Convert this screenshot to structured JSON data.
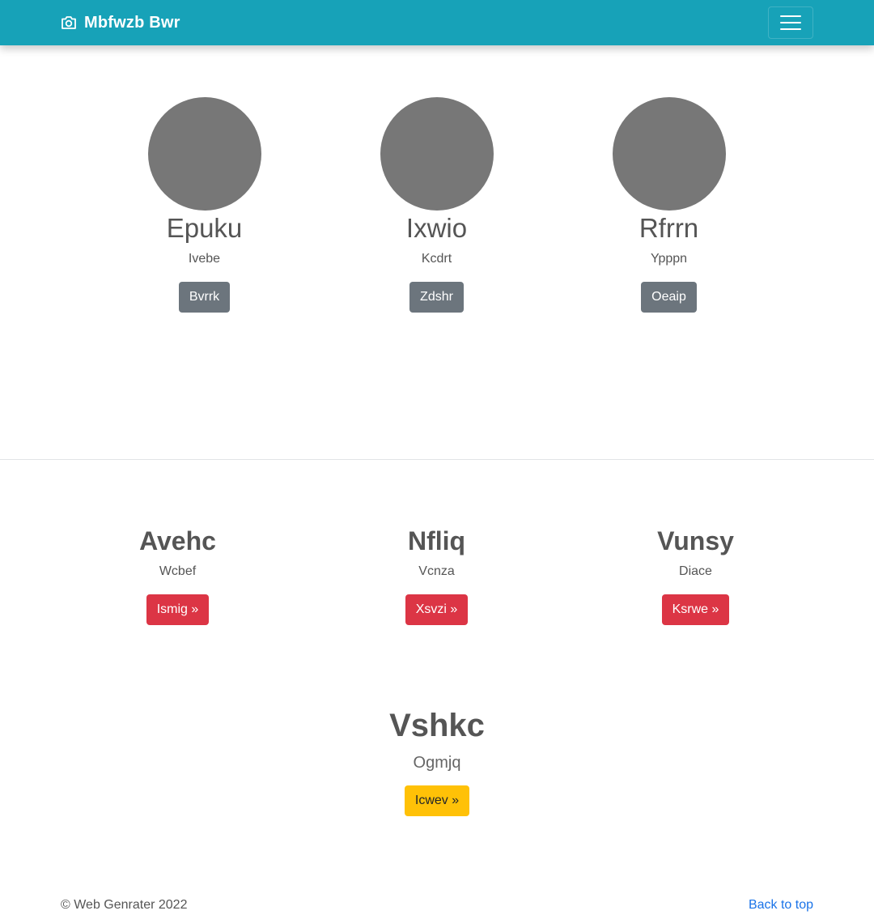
{
  "navbar": {
    "brand": "Mbfwzb Bwr",
    "brand_icon": "camera-icon",
    "toggler_icon": "hamburger-menu-icon",
    "background": "#17a2b8"
  },
  "album": {
    "items": [
      {
        "name": "Epuku",
        "subtitle": "Ivebe",
        "button": "Bvrrk"
      },
      {
        "name": "Ixwio",
        "subtitle": "Kcdrt",
        "button": "Zdshr"
      },
      {
        "name": "Rfrrn",
        "subtitle": "Ypppn",
        "button": "Oeaip"
      }
    ],
    "avatar_color": "#777777"
  },
  "marketing": {
    "columns": [
      {
        "title": "Avehc",
        "subtitle": "Wcbef",
        "button": "Ismig »"
      },
      {
        "title": "Nfliq",
        "subtitle": "Vcnza",
        "button": "Xsvzi »"
      },
      {
        "title": "Vunsy",
        "subtitle": "Diace",
        "button": "Ksrwe »"
      }
    ],
    "featured": {
      "title": "Vshkc",
      "subtitle": "Ogmjq",
      "button": "Icwev »"
    }
  },
  "footer": {
    "copyright": "© Web Genrater 2022",
    "back_to_top": "Back to top"
  },
  "colors": {
    "secondary_button": "#6c757d",
    "danger_button": "#dc3545",
    "warning_button": "#ffc107",
    "link": "#1a73e8"
  }
}
